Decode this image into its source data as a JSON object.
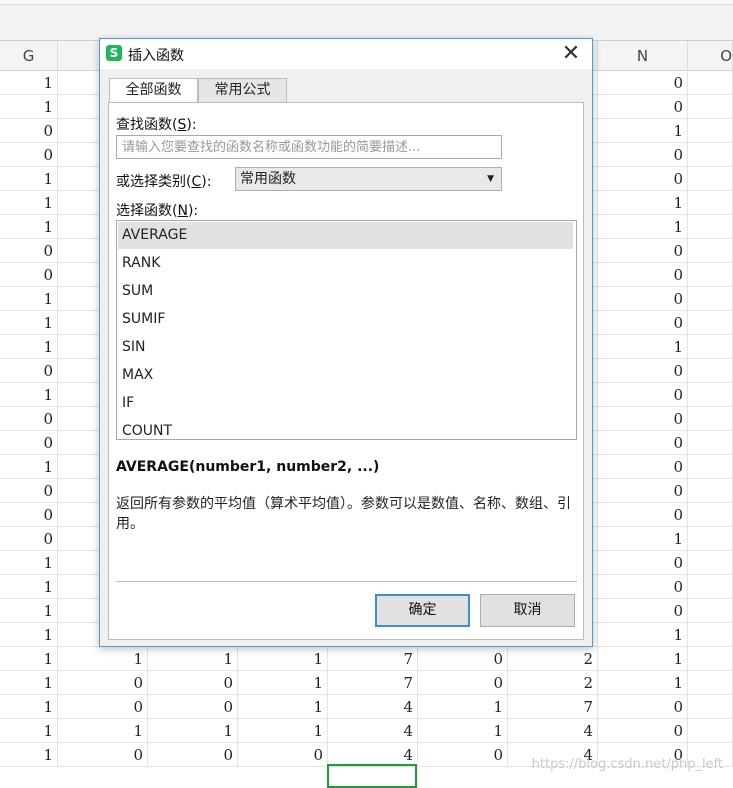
{
  "sheet": {
    "column_headers": [
      "G",
      "N",
      "O"
    ],
    "rows": [
      {
        "g": "1",
        "n": "0"
      },
      {
        "g": "1",
        "n": "0"
      },
      {
        "g": "0",
        "n": "1"
      },
      {
        "g": "0",
        "n": "0"
      },
      {
        "g": "1",
        "n": "0"
      },
      {
        "g": "1",
        "n": "1"
      },
      {
        "g": "1",
        "n": "1"
      },
      {
        "g": "0",
        "n": "0"
      },
      {
        "g": "0",
        "n": "0"
      },
      {
        "g": "1",
        "n": "0"
      },
      {
        "g": "1",
        "n": "0"
      },
      {
        "g": "1",
        "n": "1"
      },
      {
        "g": "0",
        "n": "0"
      },
      {
        "g": "1",
        "n": "0"
      },
      {
        "g": "0",
        "n": "0"
      },
      {
        "g": "0",
        "n": "0"
      },
      {
        "g": "1",
        "n": "0"
      },
      {
        "g": "0",
        "n": "0"
      },
      {
        "g": "0",
        "n": "0"
      },
      {
        "g": "0",
        "n": "1"
      },
      {
        "g": "1",
        "n": "0"
      },
      {
        "g": "1",
        "n": "0"
      },
      {
        "g": "1",
        "n": "0"
      },
      {
        "g": "1",
        "n": "1"
      },
      {
        "g": "1",
        "cells": [
          "1",
          "1",
          "1",
          "7",
          "0",
          "2"
        ],
        "n": "1"
      },
      {
        "g": "1",
        "cells": [
          "0",
          "0",
          "1",
          "7",
          "0",
          "2"
        ],
        "n": "1"
      },
      {
        "g": "1",
        "cells": [
          "0",
          "0",
          "1",
          "4",
          "1",
          "7"
        ],
        "n": "0"
      },
      {
        "g": "1",
        "cells": [
          "1",
          "1",
          "1",
          "4",
          "1",
          "4"
        ],
        "n": "0"
      },
      {
        "g": "1",
        "cells": [
          "0",
          "0",
          "0",
          "4",
          "0",
          "4"
        ],
        "n": "0"
      }
    ],
    "watermark": "https://blog.csdn.net/php_left"
  },
  "dialog": {
    "icon": "app-logo-icon",
    "icon_glyph": "S",
    "title": "插入函数",
    "close_glyph": "✕",
    "tabs": [
      {
        "label": "全部函数",
        "active": true
      },
      {
        "label": "常用公式",
        "active": false
      }
    ],
    "search_label": "查找函数(",
    "search_key": "S",
    "search_label_end": "):",
    "search_placeholder": "请输入您要查找的函数名称或函数功能的简要描述...",
    "search_value": "",
    "category_label": "或选择类别(",
    "category_key": "C",
    "category_label_end": "):",
    "category_value": "常用函数",
    "list_label": "选择函数(",
    "list_key": "N",
    "list_label_end": "):",
    "functions": [
      "AVERAGE",
      "RANK",
      "SUM",
      "SUMIF",
      "SIN",
      "MAX",
      "IF",
      "COUNT"
    ],
    "selected_function": "AVERAGE",
    "signature": "AVERAGE(number1, number2, ...)",
    "description": "返回所有参数的平均值（算术平均值）。参数可以是数值、名称、数组、引用。",
    "ok_label": "确定",
    "cancel_label": "取消"
  },
  "colors": {
    "accent": "#3c8fd0",
    "dialog_border": "#4a9fd5",
    "selection_green": "#1e9c3c",
    "app_icon": "#1fb55a"
  }
}
